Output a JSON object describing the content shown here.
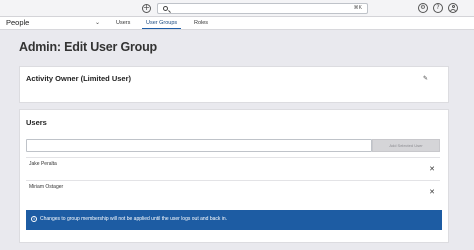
{
  "topbar": {
    "add_icon": "plus-circle-icon",
    "search": {
      "placeholder": "",
      "shortcut_hint": "⌘K"
    },
    "icons": [
      "gear-icon",
      "help-icon",
      "user-icon"
    ],
    "add_glyph": "+",
    "help_glyph": "?"
  },
  "navbar": {
    "module_label": "People",
    "module_chevron": "⌄",
    "tabs": [
      {
        "label": "Users",
        "active": false
      },
      {
        "label": "User Groups",
        "active": true
      },
      {
        "label": "Roles",
        "active": false
      }
    ]
  },
  "page": {
    "title": "Admin: Edit User Group"
  },
  "group_card": {
    "title": "Activity Owner (Limited User)",
    "edit_glyph": "✎"
  },
  "users_card": {
    "title": "Users",
    "input": {
      "value": "",
      "placeholder": ""
    },
    "add_button_label": "Add Selected User",
    "users": [
      {
        "name": "Jake Peralta"
      },
      {
        "name": "Miriam Ostager"
      }
    ],
    "remove_glyph": "✕",
    "alert": {
      "glyph": "i",
      "message": "Changes to group membership will not be applied until the user logs out and back in."
    }
  },
  "colors": {
    "accent": "#1d5ca3",
    "background": "#e9e9ee",
    "card": "#ffffff"
  }
}
